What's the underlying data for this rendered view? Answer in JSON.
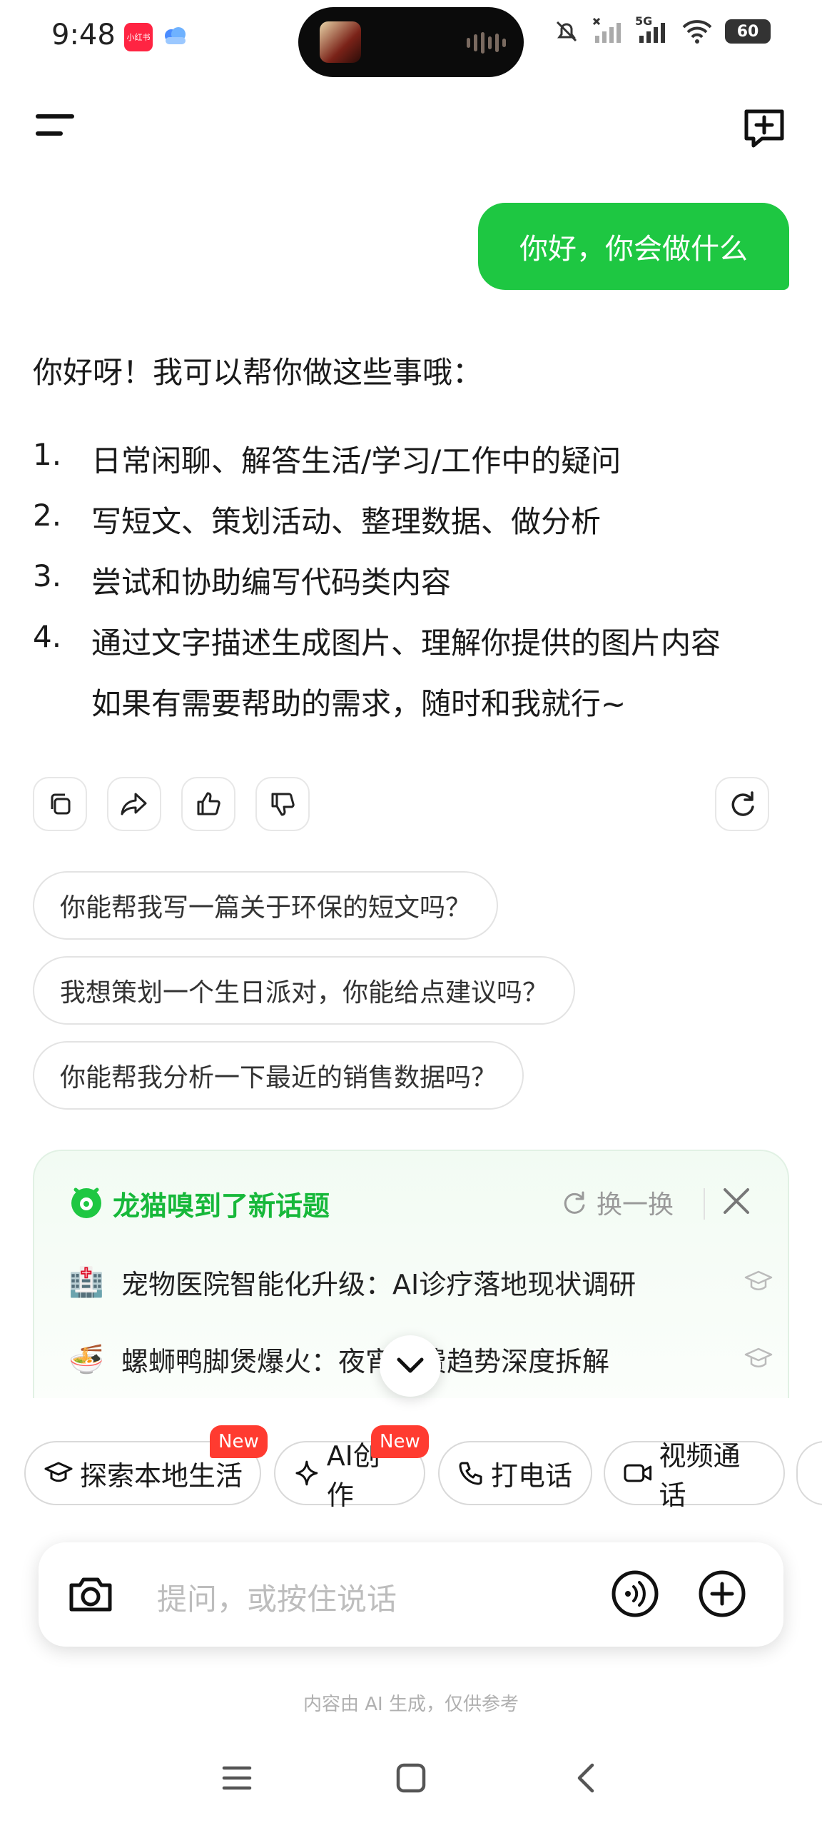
{
  "status_bar": {
    "time": "9:48",
    "app_icon_red_label": "小红书",
    "network_label": "5G",
    "battery": "60"
  },
  "conversation": {
    "user_message": "你好，你会做什么",
    "assistant_intro": "你好呀！我可以帮你做这些事哦：",
    "assistant_items": [
      {
        "num": "1.",
        "text": "日常闲聊、解答生活/学习/工作中的疑问"
      },
      {
        "num": "2.",
        "text": "写短文、策划活动、整理数据、做分析"
      },
      {
        "num": "3.",
        "text": "尝试和协助编写代码类内容"
      },
      {
        "num": "4.",
        "text": "通过文字描述生成图片、理解你提供的图片内容"
      }
    ],
    "assistant_outro": "如果有需要帮助的需求，随时和我就行~"
  },
  "suggestions": [
    "你能帮我写一篇关于环保的短文吗？",
    "我想策划一个生日派对，你能给点建议吗？",
    "你能帮我分析一下最近的销售数据吗？"
  ],
  "topics_card": {
    "title": "龙猫嗅到了新话题",
    "refresh_label": "换一换",
    "items": [
      {
        "emoji": "🏥",
        "text": "宠物医院智能化升级：AI诊疗落地现状调研"
      },
      {
        "emoji": "🍜",
        "text": "螺蛳鸭脚煲爆火：夜宵消费趋势深度拆解"
      }
    ]
  },
  "quick_actions": [
    {
      "label": "探索本地生活",
      "icon": "graduation-cap-icon",
      "badge": "New"
    },
    {
      "label": "AI创作",
      "icon": "sparkle-icon",
      "badge": "New"
    },
    {
      "label": "打电话",
      "icon": "phone-icon",
      "badge": ""
    },
    {
      "label": "视频通话",
      "icon": "video-camera-icon",
      "badge": ""
    }
  ],
  "input": {
    "placeholder": "提问，或按住说话"
  },
  "footer_note": "内容由 AI 生成，仅供参考",
  "colors": {
    "accent_green": "#1ec742",
    "badge_red": "#ff3b30"
  }
}
